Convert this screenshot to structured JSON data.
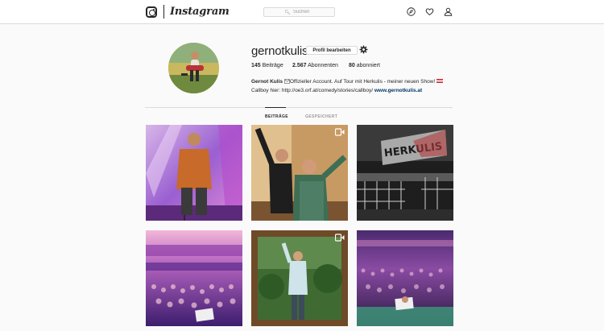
{
  "nav": {
    "logo_text": "Instagram",
    "search_placeholder": "Suchen",
    "icons": [
      "explore-compass-icon",
      "activity-heart-icon",
      "profile-person-icon"
    ]
  },
  "profile": {
    "username": "gernotkulis",
    "edit_button": "Profil bearbeiten",
    "stats": {
      "posts_count": "145",
      "posts_label": "Beiträge",
      "followers_count": "2.567",
      "followers_label": "Abonnenten",
      "following_count": "80",
      "following_label": "abonniert"
    },
    "bio": {
      "name": "Gernot Kulis",
      "line1": "Offizieller Account. Auf Tour mit Herkulis - meiner neuen Show!",
      "line2": "Callboy hier: http://oe3.orf.at/comedy/stories/callboy/",
      "website": "www.gernotkulis.at"
    }
  },
  "tabs": {
    "posts": "BEITRÄGE",
    "saved": "GESPEICHERT"
  },
  "grid": {
    "posts": [
      {
        "label": "comedian-on-stage",
        "video": false
      },
      {
        "label": "two-men-backstage",
        "video": true
      },
      {
        "label": "herkulis-stage-set",
        "video": false
      },
      {
        "label": "concert-crowd-purple",
        "video": false
      },
      {
        "label": "man-in-garden-frame",
        "video": true
      },
      {
        "label": "theatre-crowd-wide",
        "video": false
      }
    ],
    "herkulis_sign": "HERKULIS"
  },
  "colors": {
    "accent_link": "#003569",
    "border": "#dbdbdb",
    "background": "#fafafa"
  }
}
